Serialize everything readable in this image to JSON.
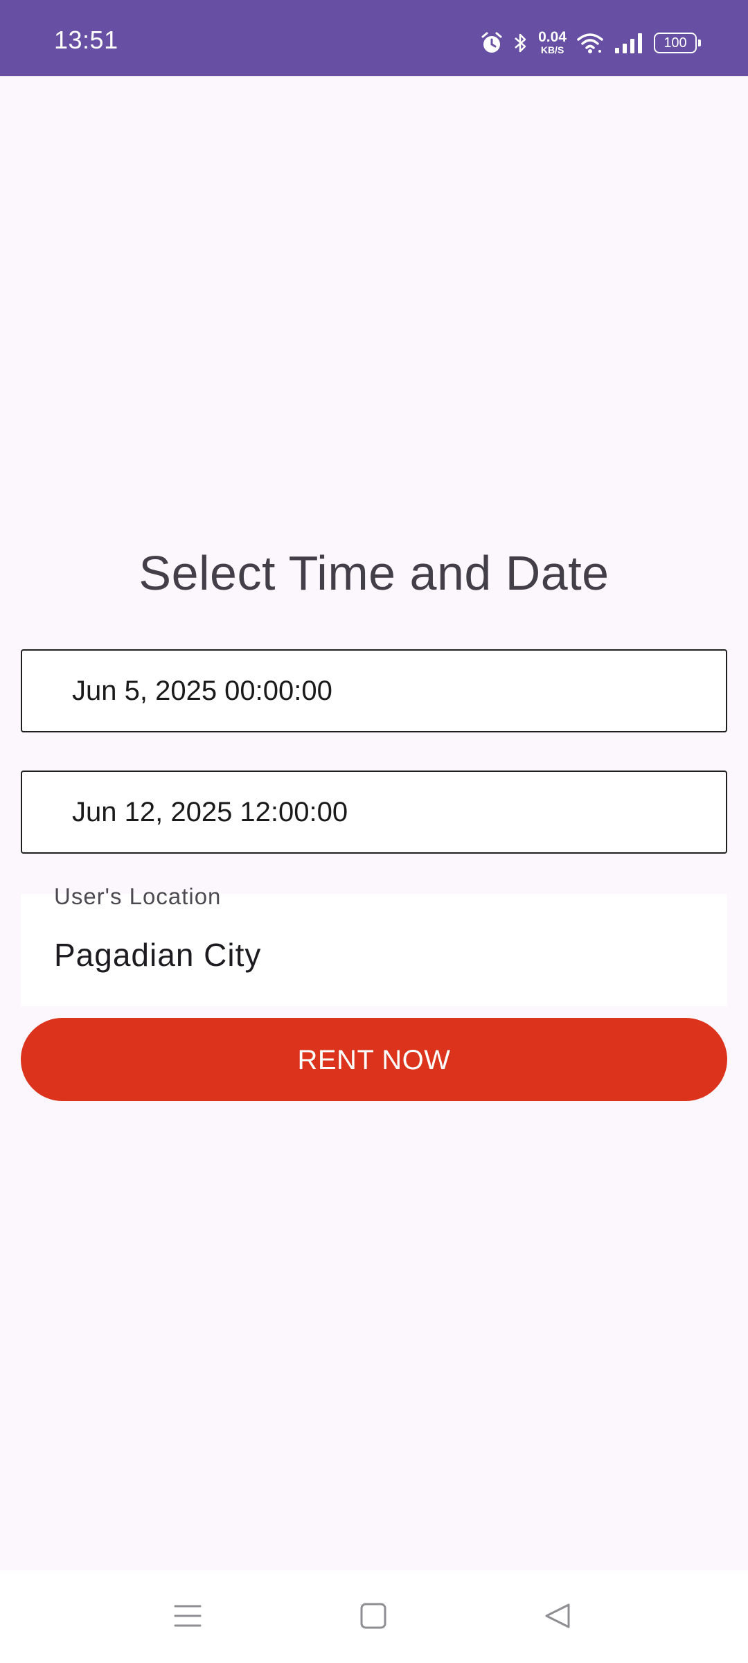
{
  "status_bar": {
    "time": "13:51",
    "net_speed_value": "0.04",
    "net_speed_unit": "KB/S",
    "battery": "100",
    "icons": [
      "alarm-icon",
      "bluetooth-icon",
      "wifi-icon",
      "signal-icon",
      "battery-icon"
    ]
  },
  "main": {
    "title": "Select Time and Date",
    "start_datetime": "Jun 5, 2025 00:00:00",
    "end_datetime": "Jun 12, 2025 12:00:00",
    "location": {
      "label": "User's Location",
      "value": "Pagadian City"
    },
    "rent_button_label": "RENT NOW"
  },
  "nav_bar": {
    "icons": [
      "menu-icon",
      "home-icon",
      "back-icon"
    ]
  },
  "colors": {
    "status_bar_bg": "#6750a4",
    "page_bg": "#fcf6fd",
    "button_bg": "#dc331c",
    "title_text": "#433f48"
  }
}
